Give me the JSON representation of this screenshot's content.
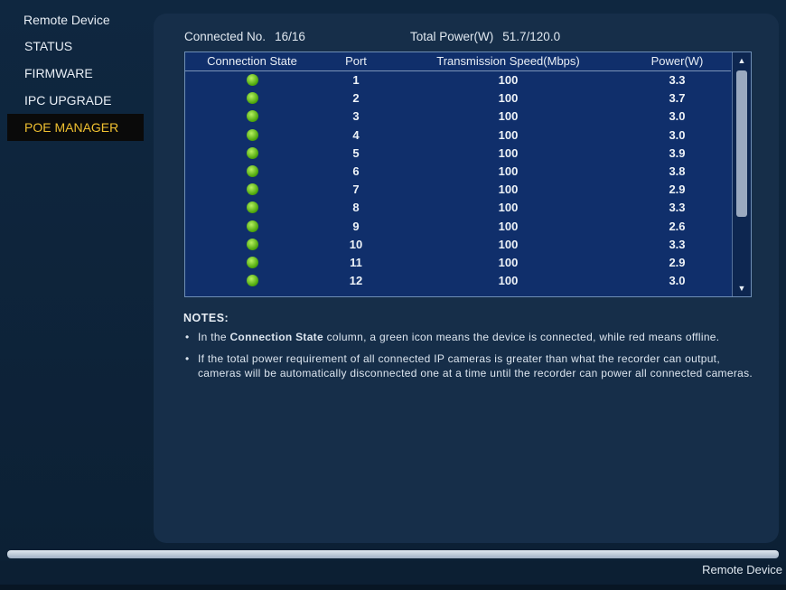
{
  "sidebar": {
    "header": "Remote Device",
    "items": [
      {
        "label": "STATUS",
        "active": false
      },
      {
        "label": "FIRMWARE",
        "active": false
      },
      {
        "label": "IPC UPGRADE",
        "active": false
      },
      {
        "label": "POE MANAGER",
        "active": true
      }
    ]
  },
  "summary": {
    "connected_label": "Connected No.",
    "connected_value": "16/16",
    "power_label": "Total Power(W)",
    "power_value": "51.7/120.0"
  },
  "table": {
    "headers": [
      "Connection State",
      "Port",
      "Transmission Speed(Mbps)",
      "Power(W)"
    ],
    "rows": [
      {
        "state": "connected",
        "port": "1",
        "speed": "100",
        "power": "3.3"
      },
      {
        "state": "connected",
        "port": "2",
        "speed": "100",
        "power": "3.7"
      },
      {
        "state": "connected",
        "port": "3",
        "speed": "100",
        "power": "3.0"
      },
      {
        "state": "connected",
        "port": "4",
        "speed": "100",
        "power": "3.0"
      },
      {
        "state": "connected",
        "port": "5",
        "speed": "100",
        "power": "3.9"
      },
      {
        "state": "connected",
        "port": "6",
        "speed": "100",
        "power": "3.8"
      },
      {
        "state": "connected",
        "port": "7",
        "speed": "100",
        "power": "2.9"
      },
      {
        "state": "connected",
        "port": "8",
        "speed": "100",
        "power": "3.3"
      },
      {
        "state": "connected",
        "port": "9",
        "speed": "100",
        "power": "2.6"
      },
      {
        "state": "connected",
        "port": "10",
        "speed": "100",
        "power": "3.3"
      },
      {
        "state": "connected",
        "port": "11",
        "speed": "100",
        "power": "2.9"
      },
      {
        "state": "connected",
        "port": "12",
        "speed": "100",
        "power": "3.0"
      }
    ]
  },
  "notes": {
    "title": "NOTES:",
    "note1_pre": "In the ",
    "note1_bold": "Connection State",
    "note1_post": " column, a green icon means the device is connected, while red means offline.",
    "note2": "If the total power requirement of all connected IP cameras is greater than what the recorder can output, cameras will be automatically disconnected one at a time until the recorder can power all connected cameras."
  },
  "footer": {
    "label": "Remote Device"
  },
  "colors": {
    "connected": "#5cb318",
    "offline": "#d02020",
    "active_item": "#f0c030"
  },
  "icons": {
    "status_dot": "status-dot-icon",
    "scroll_up": "scroll-up-icon",
    "scroll_down": "scroll-down-icon"
  }
}
